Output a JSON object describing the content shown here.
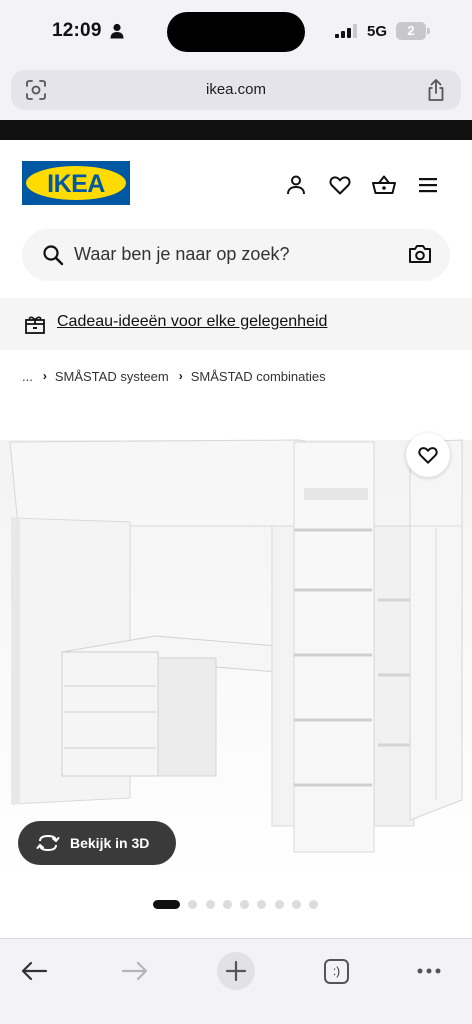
{
  "status_bar": {
    "time": "12:09",
    "network": "5G",
    "battery": "2"
  },
  "browser": {
    "url": "ikea.com"
  },
  "header": {
    "logo_text": "IKEA",
    "brand_colors": {
      "blue": "#0058a3",
      "yellow": "#ffdb00"
    },
    "icons": [
      "user-icon",
      "heart-icon",
      "basket-icon",
      "menu-icon"
    ]
  },
  "search": {
    "placeholder": "Waar ben je naar op zoek?"
  },
  "promo": {
    "text": "Cadeau-ideeën voor elke gelegenheid"
  },
  "breadcrumb": {
    "ellipsis": "...",
    "items": [
      "SMÅSTAD systeem",
      "SMÅSTAD combinaties"
    ]
  },
  "product": {
    "view_3d_label": "Bekijk in 3D",
    "gallery": {
      "count": 10,
      "active_index": 0
    }
  },
  "toolbar": {
    "tabs_label": ":)"
  }
}
